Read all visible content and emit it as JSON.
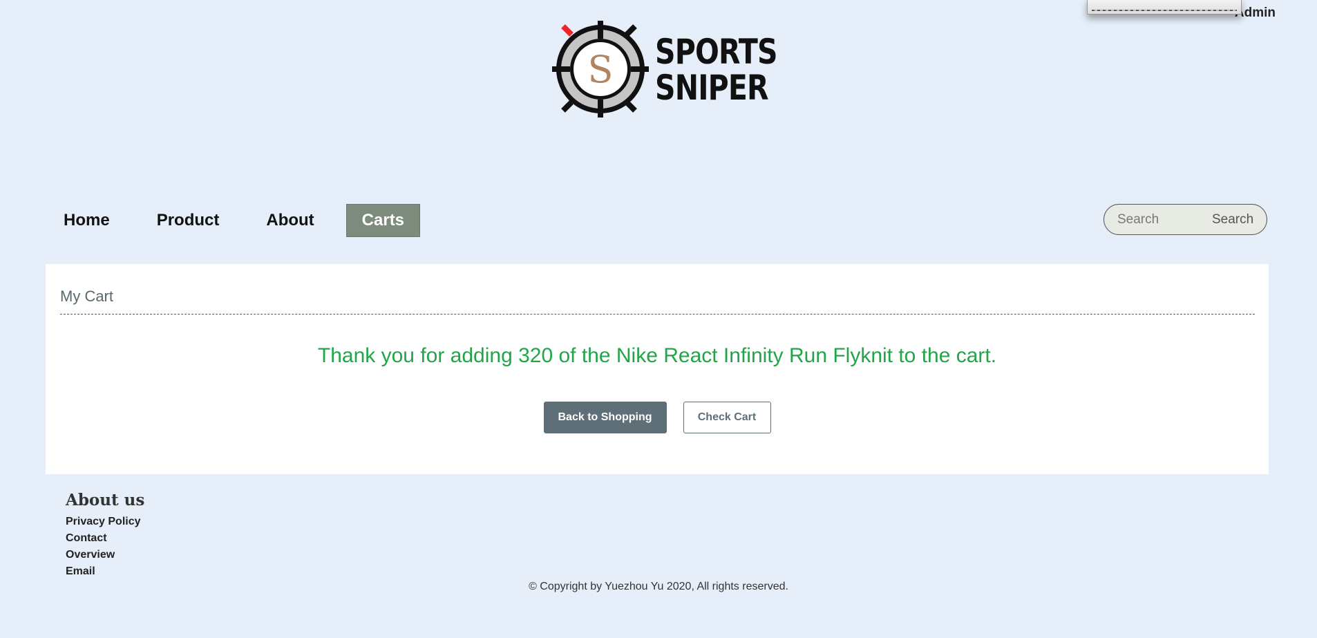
{
  "user": {
    "name": "Admin"
  },
  "brand": {
    "line1": "SPORTS",
    "line2": "SNIPER",
    "emblem_letter": "S"
  },
  "nav": {
    "items": [
      {
        "label": "Home"
      },
      {
        "label": "Product"
      },
      {
        "label": "About"
      },
      {
        "label": "Carts",
        "active": true
      }
    ]
  },
  "search": {
    "placeholder": "Search",
    "button_label": "Search"
  },
  "cart": {
    "title": "My Cart",
    "message": "Thank you for adding 320 of the Nike React Infinity Run Flyknit to the cart.",
    "back_button": "Back to Shopping",
    "check_button": "Check Cart"
  },
  "footer": {
    "heading": "About us",
    "links": [
      "Privacy Policy",
      "Contact",
      "Overview",
      "Email"
    ],
    "copyright": "© Copyright by Yuezhou Yu 2020, All rights reserved."
  },
  "colors": {
    "page_bg": "#e5eef9",
    "nav_active_bg": "#7c8b7c",
    "success_text": "#22a548",
    "primary_button": "#5f6f78"
  }
}
